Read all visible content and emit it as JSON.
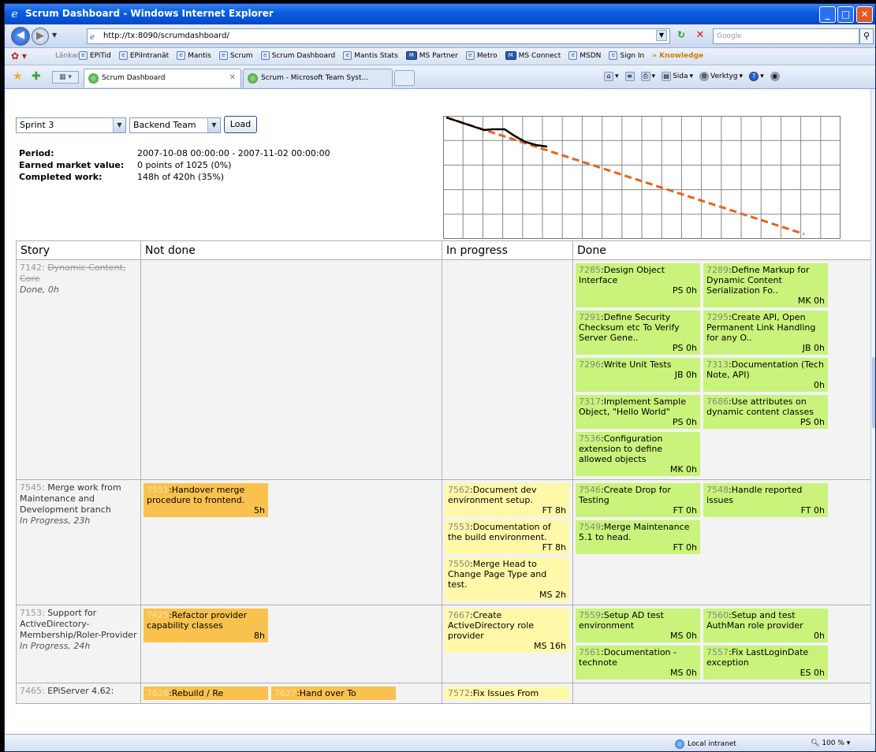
{
  "window": {
    "title": "Scrum Dashboard - Windows Internet Explorer"
  },
  "address": {
    "url": "http://tx:8090/scrumdashboard/",
    "search_placeholder": "Google"
  },
  "links_bar": {
    "label": "Länkar",
    "items": [
      "EPiTid",
      "EPiIntranät",
      "Mantis",
      "Scrum",
      "Scrum Dashboard",
      "Mantis Stats",
      "MS Partner",
      "Metro",
      "MS Connect",
      "MSDN",
      "Sign In"
    ],
    "more": "Knowledge"
  },
  "tabs": {
    "active": "Scrum Dashboard",
    "inactive": "Scrum - Microsoft Team Syst..."
  },
  "command_bar": {
    "page": "Sida",
    "tools": "Verktyg"
  },
  "controls": {
    "sprint": "Sprint 3",
    "team": "Backend Team",
    "load": "Load"
  },
  "summary": {
    "period_label": "Period:",
    "period_value": "2007-10-08 00:00:00 - 2007-11-02 00:00:00",
    "emv_label": "Earned market value:",
    "emv_value": "0 points of 1025 (0%)",
    "completed_label": "Completed work:",
    "completed_value": "148h of 420h (35%)"
  },
  "burndown": {
    "grid_cols": 20,
    "grid_rows": 5,
    "ideal_color": "#e8631a",
    "actual_color": "#000000"
  },
  "board": {
    "headers": [
      "Story",
      "Not done",
      "In progress",
      "Done"
    ],
    "rows": [
      {
        "id": "7142",
        "title": "Dynamic Content, Core",
        "status": "Done, 0h",
        "done": true,
        "not_done": [],
        "in_progress": [],
        "done_cards": [
          {
            "id": "7285",
            "title": "Design Object Interface",
            "meta": "PS 0h"
          },
          {
            "id": "7289",
            "title": "Define Markup for Dynamic Content Serialization Fo..",
            "meta": "MK 0h"
          },
          {
            "id": "7291",
            "title": "Define Security Checksum etc To Verify Server Gene..",
            "meta": "PS 0h"
          },
          {
            "id": "7295",
            "title": "Create API, Open Permanent Link Handling for any O..",
            "meta": "JB 0h"
          },
          {
            "id": "7296",
            "title": "Write Unit Tests",
            "meta": "JB 0h"
          },
          {
            "id": "7313",
            "title": "Documentation (Tech Note, API)",
            "meta": "0h"
          },
          {
            "id": "7317",
            "title": "Implement Sample Object, \"Hello World\"",
            "meta": "PS 0h"
          },
          {
            "id": "7686",
            "title": "Use attributes on dynamic content classes",
            "meta": "PS 0h"
          },
          {
            "id": "7536",
            "title": "Configuration extension to define allowed objects",
            "meta": "MK 0h"
          }
        ]
      },
      {
        "id": "7545",
        "title": "Merge work from Maintenance and Development branch",
        "status": "In Progress, 23h",
        "done": false,
        "not_done": [
          {
            "id": "7551",
            "title": "Handover merge procedure to frontend.",
            "meta": "5h"
          }
        ],
        "in_progress": [
          {
            "id": "7562",
            "title": "Document dev environment setup.",
            "meta": "FT 8h"
          },
          {
            "id": "7553",
            "title": "Documentation of the build environment.",
            "meta": "FT 8h"
          },
          {
            "id": "7550",
            "title": "Merge Head to Change Page Type and test.",
            "meta": "MS 2h"
          }
        ],
        "done_cards": [
          {
            "id": "7546",
            "title": "Create Drop for Testing",
            "meta": "FT 0h"
          },
          {
            "id": "7548",
            "title": "Handle reported issues",
            "meta": "FT 0h"
          },
          {
            "id": "7549",
            "title": "Merge Maintenance 5.1 to head.",
            "meta": "FT 0h"
          }
        ]
      },
      {
        "id": "7153",
        "title": "Support for ActiveDirectory-Membership/Roler-Provider",
        "status": "In Progress, 24h",
        "done": false,
        "not_done": [
          {
            "id": "7625",
            "title": "Refactor provider capability classes",
            "meta": "8h"
          }
        ],
        "in_progress": [
          {
            "id": "7667",
            "title": "Create ActiveDirectory role provider",
            "meta": "MS 16h"
          }
        ],
        "done_cards": [
          {
            "id": "7559",
            "title": "Setup AD test environment",
            "meta": "MS 0h"
          },
          {
            "id": "7560",
            "title": "Setup and test AuthMan role provider",
            "meta": "0h"
          },
          {
            "id": "7561",
            "title": "Documentation - technote",
            "meta": "MS 0h"
          },
          {
            "id": "7557",
            "title": "Fix LastLoginDate exception",
            "meta": "ES 0h"
          }
        ]
      },
      {
        "id": "7465",
        "title": "EPiServer 4.62:",
        "status": "",
        "done": false,
        "not_done": [
          {
            "id": "7626",
            "title": "Rebuild / Re",
            "meta": ""
          },
          {
            "id": "7627",
            "title": "Hand over To",
            "meta": ""
          }
        ],
        "in_progress": [
          {
            "id": "7572",
            "title": "Fix Issues From",
            "meta": ""
          }
        ],
        "done_cards": []
      }
    ]
  },
  "statusbar": {
    "zone": "Local intranet",
    "zoom": "100 %"
  }
}
